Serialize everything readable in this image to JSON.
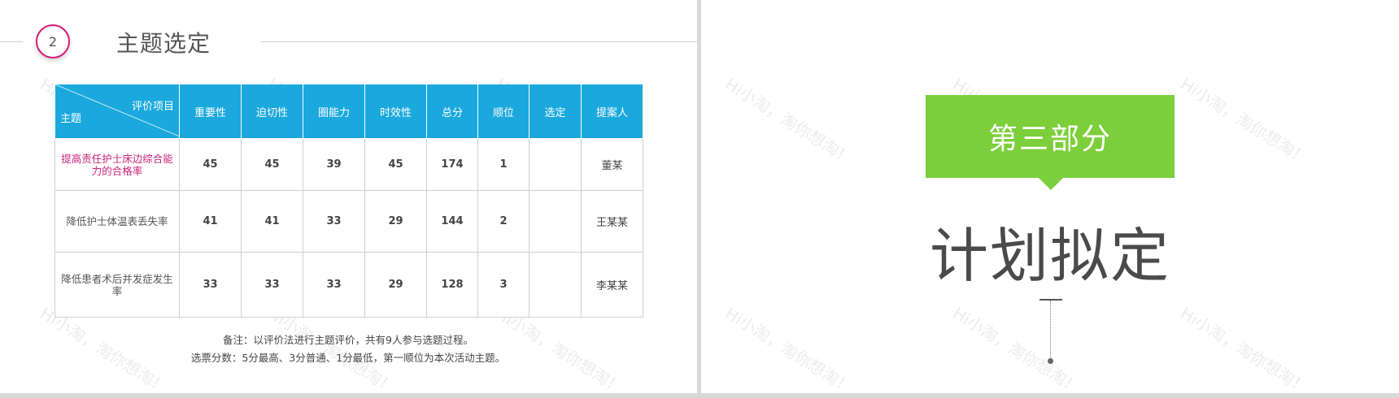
{
  "left_slide": {
    "section_number": "2",
    "section_title": "主题选定",
    "table": {
      "corner_top": "评价项目",
      "corner_bottom": "主题",
      "headers": [
        "重要性",
        "迫切性",
        "圈能力",
        "时效性",
        "总分",
        "顺位",
        "选定",
        "提案人"
      ],
      "rows": [
        {
          "topic": "提高责任护士床边综合能力的合格率",
          "values": [
            "45",
            "45",
            "39",
            "45",
            "174",
            "1",
            "",
            "董某"
          ]
        },
        {
          "topic": "降低护士体温表丢失率",
          "values": [
            "41",
            "41",
            "33",
            "29",
            "144",
            "2",
            "",
            "王某某"
          ]
        },
        {
          "topic": "降低患者术后并发症发生率",
          "values": [
            "33",
            "33",
            "33",
            "29",
            "128",
            "3",
            "",
            "李某某"
          ]
        }
      ]
    },
    "notes": [
      "备注：以评价法进行主题评价，共有9人参与选题过程。",
      "选票分数：5分最高、3分普通、1分最低，第一顺位为本次活动主题。"
    ]
  },
  "right_slide": {
    "part_label": "第三部分",
    "title": "计划拟定"
  },
  "watermark_text": "Hi小淘，淘你想淘！",
  "colors": {
    "accent_magenta": "#d81b73",
    "table_header_blue": "#1aa8dd",
    "highlight_green": "#7ccf3a"
  }
}
